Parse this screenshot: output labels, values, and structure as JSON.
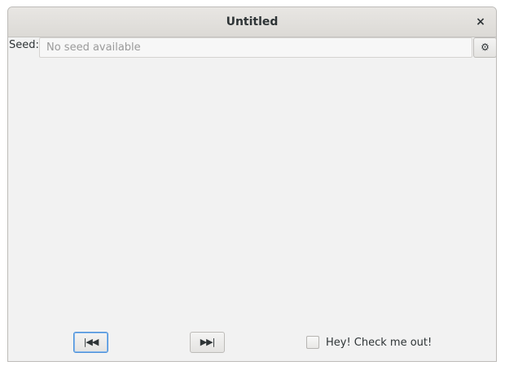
{
  "window": {
    "title": "Untitled",
    "close_glyph": "×"
  },
  "seed": {
    "label": "Seed:",
    "value": "",
    "placeholder": "No seed available",
    "settings_icon": "gear-icon",
    "settings_glyph": "⚙"
  },
  "controls": {
    "first_glyph": "|◀◀",
    "last_glyph": "▶▶|",
    "checkbox_label": "Hey! Check me out!",
    "checkbox_checked": false
  }
}
